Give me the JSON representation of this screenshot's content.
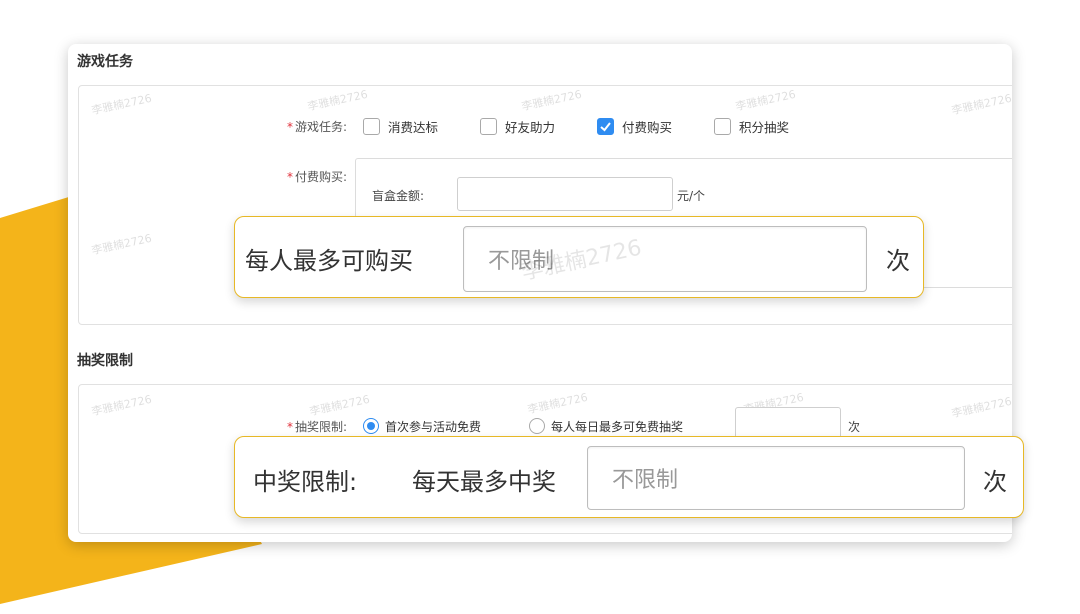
{
  "colors": {
    "accent_yellow": "#f4b41a",
    "checkbox_blue": "#2f8cf1",
    "required_red": "#e0303a",
    "callout_border": "#e7b826"
  },
  "watermark": "李雅楠2726",
  "game_task": {
    "title": "游戏任务",
    "task_label": "游戏任务:",
    "options": [
      {
        "label": "消费达标",
        "checked": false
      },
      {
        "label": "好友助力",
        "checked": false
      },
      {
        "label": "付费购买",
        "checked": true
      },
      {
        "label": "积分抽奖",
        "checked": false
      }
    ],
    "paid_label": "付费购买:",
    "box_amount_label": "盲盒金额:",
    "box_amount_unit": "元/个"
  },
  "lottery_limit": {
    "title": "抽奖限制",
    "limit_label": "抽奖限制:",
    "radio_first": "首次参与活动免费",
    "radio_daily": "每人每日最多可免费抽奖",
    "unit": "次"
  },
  "callout_purchase": {
    "label": "每人最多可购买",
    "placeholder": "不限制",
    "unit": "次"
  },
  "callout_win": {
    "label": "中奖限制:",
    "sublabel": "每天最多中奖",
    "placeholder": "不限制",
    "unit": "次"
  }
}
